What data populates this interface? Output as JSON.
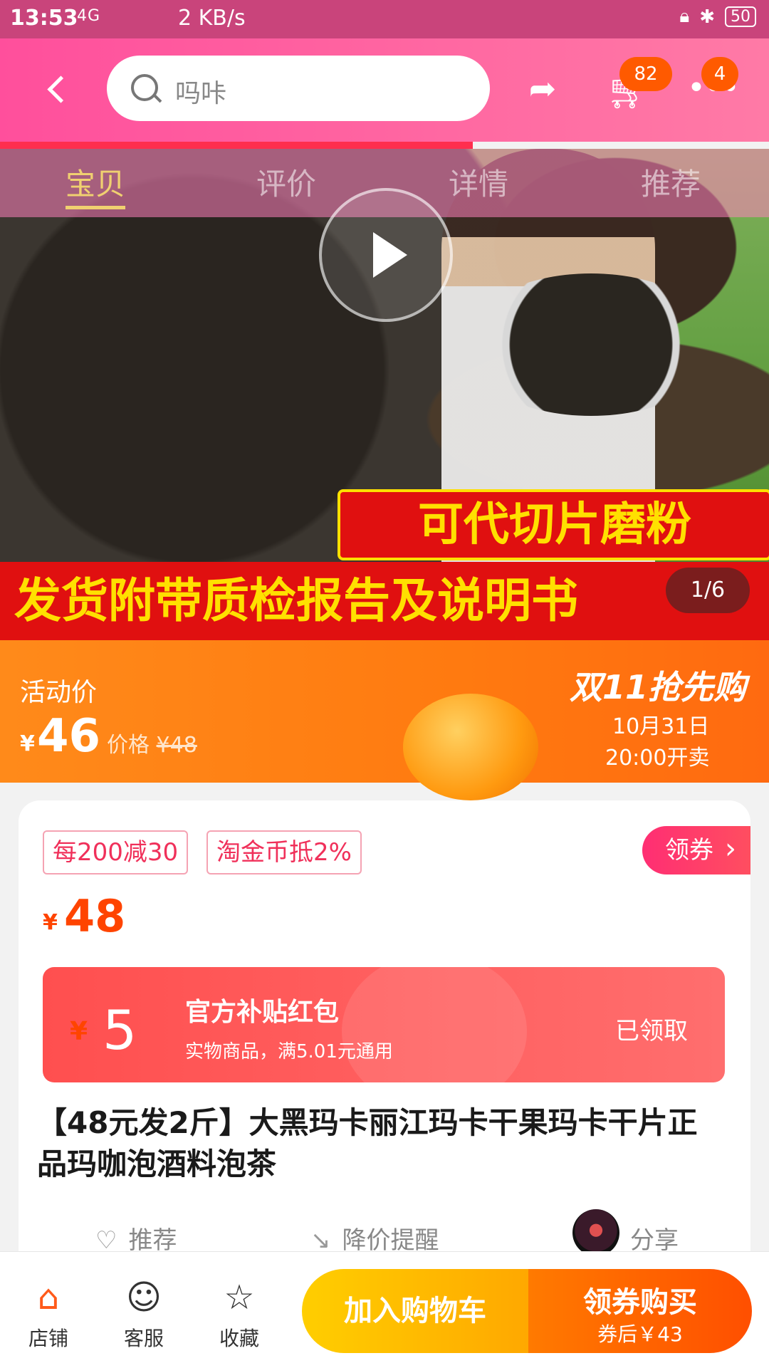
{
  "status_bar": {
    "time": "13:53",
    "network": "4G",
    "speed": "2 KB/s",
    "battery": "50"
  },
  "top_bar": {
    "search_placeholder": "吗咔",
    "cart_count": "82",
    "message_count": "4"
  },
  "tabs": [
    "宝贝",
    "评价",
    "详情",
    "推荐"
  ],
  "gallery": {
    "banner_1": "可代切片磨粉",
    "banner_2": "发货附带质检报告及说明书",
    "counter": "1/6"
  },
  "promo": {
    "label": "活动价",
    "currency": "¥",
    "price": "46",
    "orig_label": "价格",
    "orig_price": "¥48",
    "event": "双11抢先购",
    "date": "10月31日",
    "time": "20:00开卖"
  },
  "info": {
    "chips": [
      "每200减30",
      "淘金币抵2%"
    ],
    "coupon_btn": "领券",
    "currency": "¥",
    "price": "48",
    "red_packet": {
      "currency": "¥",
      "amount": "5",
      "title": "官方补贴红包",
      "subtitle": "实物商品，满5.01元通用",
      "status": "已领取"
    },
    "title": "【48元发2斤】大黑玛卡丽江玛卡干果玛卡干片正品玛咖泡酒料泡茶",
    "actions": [
      "推荐",
      "降价提醒",
      "分享"
    ]
  },
  "bottom_bar": {
    "items": [
      {
        "label": "店铺",
        "icon": "store-icon"
      },
      {
        "label": "客服",
        "icon": "service-icon"
      },
      {
        "label": "收藏",
        "icon": "star-icon"
      }
    ],
    "add_cart": "加入购物车",
    "buy": "领券购买",
    "buy_sub": "券后￥43"
  },
  "colors": {
    "accent": "#ff4f9c",
    "orange": "#ff7a10",
    "price": "#ff4400"
  }
}
